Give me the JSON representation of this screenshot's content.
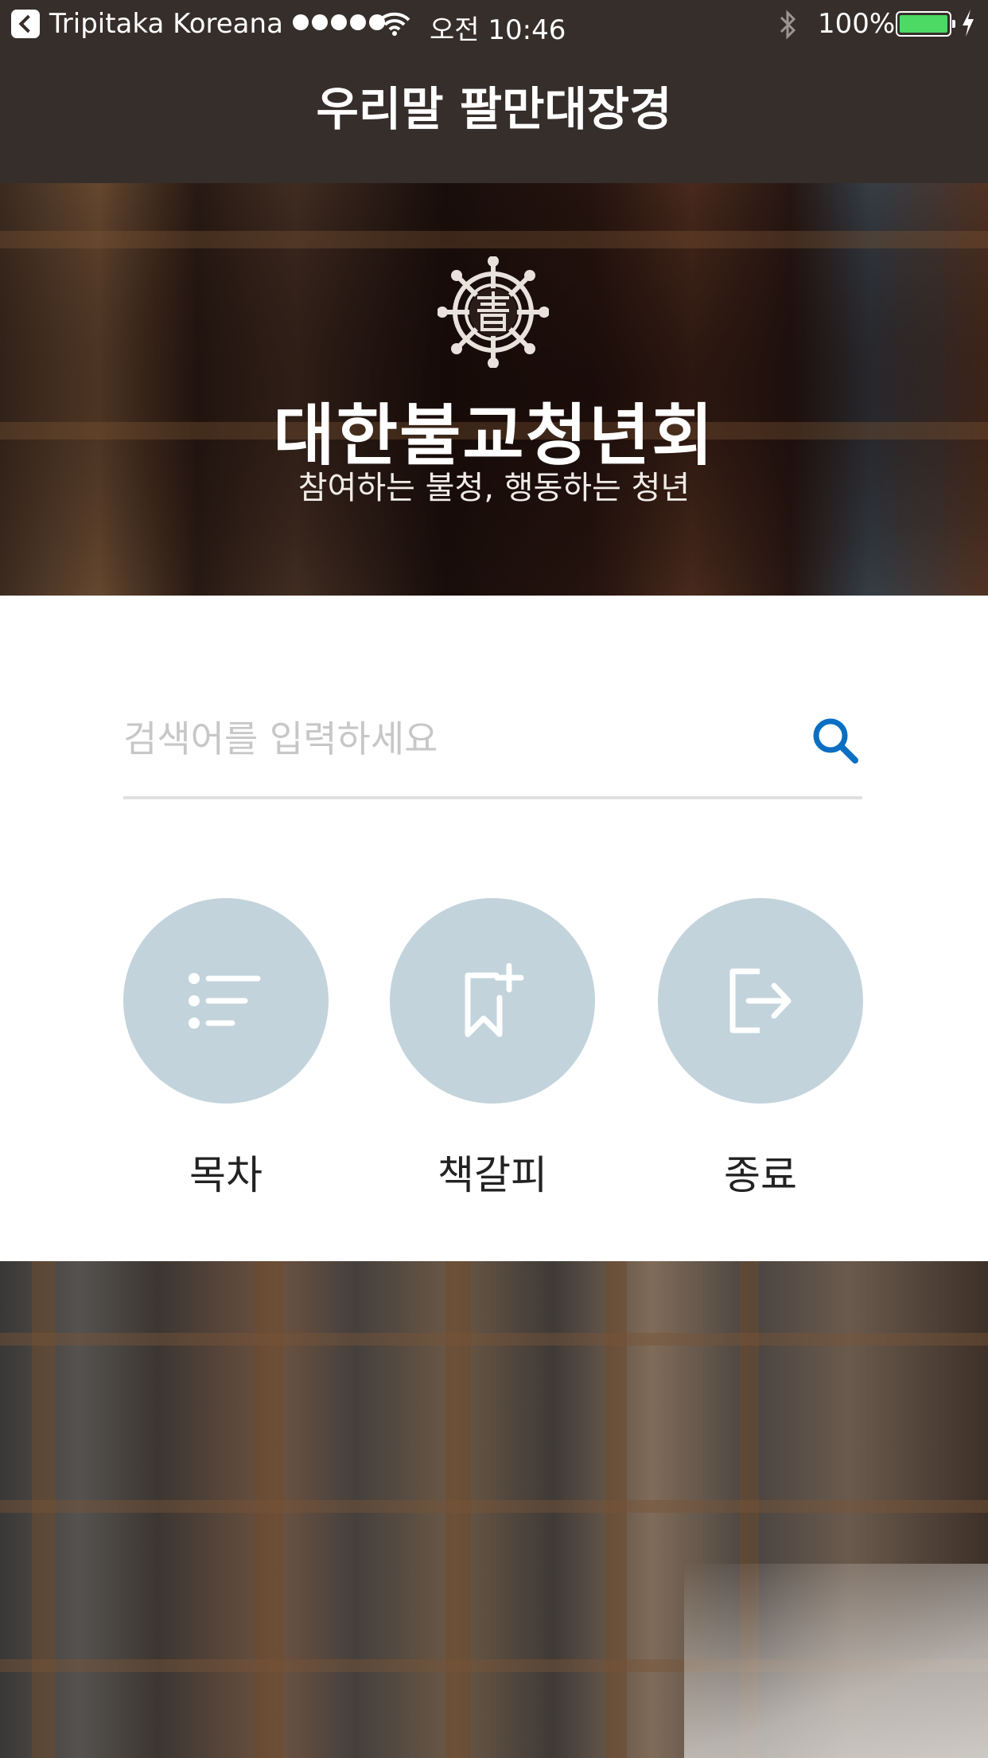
{
  "status_bar": {
    "back_app": "Tripitaka Koreana",
    "time": "오전 10:46",
    "battery": "100%",
    "battery_level": 1.0,
    "battery_color": "#4cd964",
    "icons": [
      "back-icon",
      "signal-icon",
      "wifi-icon",
      "bluetooth-icon",
      "battery-icon",
      "charging-icon"
    ]
  },
  "nav": {
    "title": "우리말 팔만대장경"
  },
  "hero": {
    "emblem_icon": "dharma-wheel-emblem",
    "org_name": "대한불교청년회",
    "slogan": "참여하는 불청, 행동하는 청년"
  },
  "search": {
    "placeholder": "검색어를 입력하세요",
    "value": "",
    "icon": "search-icon",
    "icon_color": "#0a6fc2"
  },
  "actions": [
    {
      "label": "목차",
      "icon": "list-icon"
    },
    {
      "label": "책갈피",
      "icon": "bookmark-add-icon"
    },
    {
      "label": "종료",
      "icon": "exit-icon"
    }
  ],
  "colors": {
    "header_bg": "#362e2b",
    "action_circle": "#c2d3dc"
  }
}
